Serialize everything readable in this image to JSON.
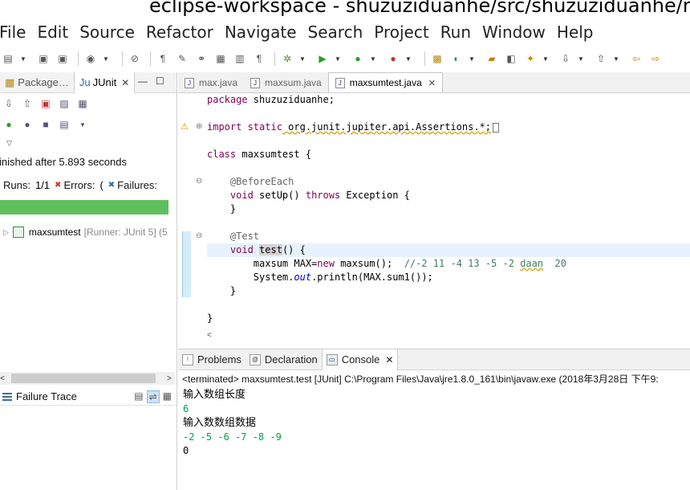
{
  "window": {
    "title": "eclipse-workspace - shuzuziduanhe/src/shuzuziduanhe/m"
  },
  "menu": [
    "File",
    "Edit",
    "Source",
    "Refactor",
    "Navigate",
    "Search",
    "Project",
    "Run",
    "Window",
    "Help"
  ],
  "left_panel": {
    "tabs": [
      {
        "label": "Package"
      },
      {
        "label": "JUnit"
      }
    ],
    "junit": {
      "finished": "inished after 5.893 seconds",
      "runs_label": "Runs:",
      "runs_value": "1/1",
      "errors_label": "Errors:",
      "errors_value": "(",
      "failures_label": "Failures:",
      "status_color": "#5fbf5c",
      "tree_item": "maxsumtest",
      "tree_runner": "[Runner: JUnit 5] (5"
    },
    "failure_trace_label": "Failure Trace"
  },
  "editor": {
    "tabs": [
      {
        "label": "max.java",
        "active": false
      },
      {
        "label": "maxsum.java",
        "active": false
      },
      {
        "label": "maxsumtest.java",
        "active": true
      }
    ],
    "code": {
      "l1_kw": "package",
      "l1_rest": " shuzuziduanhe;",
      "l3_kw": "import static",
      "l3_rest": " org.junit.jupiter.api.Assertions.*;",
      "l5_kw": "class",
      "l5_rest": " maxsumtest {",
      "l7_an": "@BeforeEach",
      "l8_kw1": "void",
      "l8_mid": " setUp() ",
      "l8_kw2": "throws",
      "l8_rest": " Exception {",
      "l9": "}",
      "l11_an": "@Test",
      "l12_kw": "void",
      "l12_name": "test",
      "l12_rest": "() {",
      "l13_a": "maxsum ",
      "l13_var": "MAX",
      "l13_eq": "=",
      "l13_kw": "new",
      "l13_b": " maxsum();  ",
      "l13_cm1": "//-2 11 -4 13 -5 -2 ",
      "l13_cm_ul": "daan",
      "l13_cm2": "  20",
      "l14_a": "System.",
      "l14_fld": "out",
      "l14_b": ".println(MAX.sum1());",
      "l15": "}",
      "l17": "}"
    }
  },
  "bottom_panel": {
    "tabs": [
      {
        "label": "Problems"
      },
      {
        "label": "Declaration"
      },
      {
        "label": "Console"
      }
    ],
    "console_header": "<terminated> maxsumtest.test [JUnit] C:\\Program Files\\Java\\jre1.8.0_161\\bin\\javaw.exe (2018年3月28日 下午9:",
    "lines": [
      {
        "text": "输入数组长度",
        "kind": "out"
      },
      {
        "text": "6",
        "kind": "in"
      },
      {
        "text": "输入数数组数据",
        "kind": "out"
      },
      {
        "text": "-2 -5 -6 -7 -8 -9",
        "kind": "in"
      },
      {
        "text": "0",
        "kind": "out"
      }
    ],
    "input_color": "#00a050"
  }
}
